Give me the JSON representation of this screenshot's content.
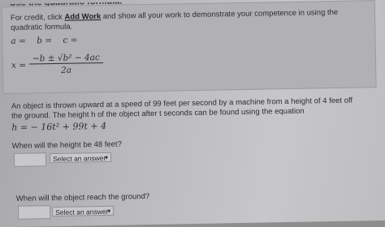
{
  "header": {
    "top_text": "Use the quadratic formula."
  },
  "instructions": {
    "prefix": "For credit, click ",
    "link": "Add Work",
    "suffix": " and show all your work to demonstrate your competence in using the quadratic formula."
  },
  "variables": {
    "a": "a =",
    "b": "b =",
    "c": "c ="
  },
  "formula": {
    "lhs": "x =",
    "numerator": "−b ± √b² − 4ac",
    "denominator": "2a"
  },
  "problem": {
    "text": "An object is thrown upward at a speed of 99 feet per second by a machine from a height of 4 feet off the ground. The height h of the object after t seconds can be found using the equation",
    "equation": "h = − 16t² + 99t + 4"
  },
  "questions": [
    {
      "prompt": "When will the height be 48 feet?",
      "select_value": "Select an answer"
    },
    {
      "prompt": "When will the object reach the ground?",
      "select_value": "Select an answer"
    }
  ],
  "icons": {
    "dropdown": "chevron-down-icon"
  }
}
